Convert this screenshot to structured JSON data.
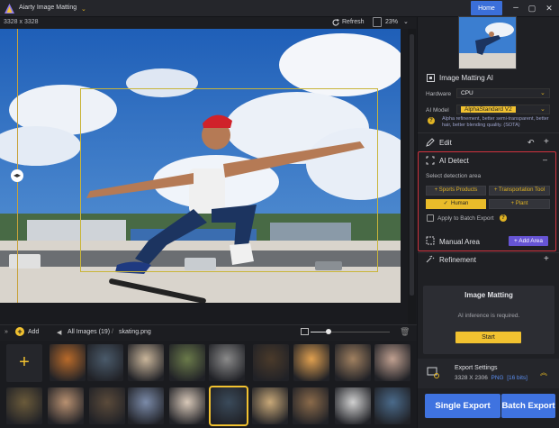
{
  "titlebar": {
    "app_title": "Aiarty Image Matting",
    "home_label": "Home",
    "minimize": "–",
    "maximize": "▢",
    "close": "✕"
  },
  "canvas_bar": {
    "dimensions": "3328 x 3328",
    "refresh_label": "Refresh",
    "zoom": "23%"
  },
  "gallery_bar": {
    "add_label": "Add",
    "all_images": "All Images (19)",
    "current_file": "skating.png"
  },
  "gallery": {
    "thumb_count": 19,
    "thumb_colors": [
      "#b86a2a",
      "#4a5a6a",
      "#c9b59a",
      "#6a7a4a",
      "#8a8a8a",
      "#4a3a2a",
      "#e0a050",
      "#a08060",
      "#c0a090",
      "#6a5a3a",
      "#b89070",
      "#5a4a3a",
      "#7a8aa8",
      "#d8c8b8",
      "#3a4a5a",
      "#c8a878",
      "#8a6a4a",
      "#d0d0d0",
      "#4a6a8a"
    ]
  },
  "panel": {
    "image_matting_ai": "Image Matting AI",
    "hardware_label": "Hardware",
    "hardware_value": "CPU",
    "ai_model_label": "AI Model",
    "ai_model_value": "AlphaStandard  V2",
    "model_desc": "Alpha refinement, better semi-transparent, better hair, better blending quality. (SOTA)",
    "edit_label": "Edit",
    "ai_detect_label": "AI Detect",
    "select_area": "Select detection area",
    "categories": [
      "Sports Products",
      "Transportation Tool",
      "Human",
      "Plant"
    ],
    "apply_batch": "Apply to Batch Export",
    "manual_area": "Manual Area",
    "add_area": "+ Add Area",
    "refinement": "Refinement",
    "im_title": "Image Matting",
    "im_msg": "AI inference is required.",
    "start": "Start",
    "export_settings": "Export Settings",
    "export_dims": "3328 X 2306",
    "export_fmt": "PNG",
    "export_bits": "[16 bits]",
    "single_export": "Single Export",
    "batch_export": "Batch Export"
  },
  "colors": {
    "accent": "#f2c230",
    "primary_blue": "#3f73e0",
    "alert_red": "#d2333f",
    "add_area_purple": "#6654d4"
  }
}
